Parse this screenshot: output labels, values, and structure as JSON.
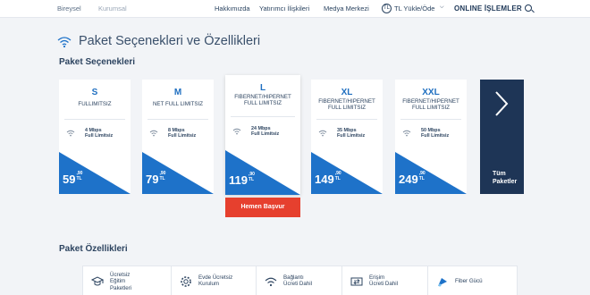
{
  "topbar": {
    "segment_personal": "Bireysel",
    "segment_corporate": "Kurumsal",
    "nav": [
      "Hakkımızda",
      "Yatırımcı İlişkileri",
      "Medya Merkezi"
    ],
    "tl_globe": "TL",
    "topup": "TL Yükle/Öde",
    "online": "ONLINE İŞLEMLER"
  },
  "page_title": "Paket Seçenekleri ve Özellikleri",
  "packages_section_title": "Paket Seçenekleri",
  "packages": [
    {
      "size": "S",
      "type": "FULLIMITSIZ",
      "speed_line1": "4 Mbps",
      "speed_line2": "Full Limitsiz",
      "price": "59",
      "price_dec": ",90",
      "price_cur": "TL"
    },
    {
      "size": "M",
      "type": "NET FULL LIMITSIZ",
      "speed_line1": "8 Mbps",
      "speed_line2": "Full Limitsiz",
      "price": "79",
      "price_dec": ",90",
      "price_cur": "TL"
    },
    {
      "size": "L",
      "type": "FIBERNET/HIPERNET FULL LIMITSIZ",
      "speed_line1": "24 Mbps",
      "speed_line2": "Full Limitsiz",
      "price": "119",
      "price_dec": ",90",
      "price_cur": "TL"
    },
    {
      "size": "XL",
      "type": "FIBERNET/HIPERNET FULL LIMITSIZ",
      "speed_line1": "35 Mbps",
      "speed_line2": "Full Limitsiz",
      "price": "149",
      "price_dec": ",90",
      "price_cur": "TL"
    },
    {
      "size": "XXL",
      "type": "FIBERNET/HIPERNET FULL LIMITSIZ",
      "speed_line1": "50 Mbps",
      "speed_line2": "Full Limitsiz",
      "price": "249",
      "price_dec": ",90",
      "price_cur": "TL"
    }
  ],
  "cta_label": "Hemen Başvur",
  "all_packages": {
    "line1": "Tüm",
    "line2": "Paketler"
  },
  "features_section_title": "Paket Özellikleri",
  "features": [
    {
      "line1": "Ücretsiz",
      "line2": "Eğitim",
      "line3": "Paketleri"
    },
    {
      "line1": "Evde Ücretsiz",
      "line2": "Kurulum",
      "line3": ""
    },
    {
      "line1": "Bağlantı",
      "line2": "Ücreti Dahil",
      "line3": ""
    },
    {
      "line1": "Erişim",
      "line2": "Ücreti Dahil",
      "line3": ""
    },
    {
      "line1": "Fiber Gücü",
      "line2": "",
      "line3": ""
    }
  ],
  "colors": {
    "brand_blue": "#1e72c9",
    "navy": "#1e3556",
    "cta_red": "#e6402e",
    "background": "#f2f4f7"
  }
}
